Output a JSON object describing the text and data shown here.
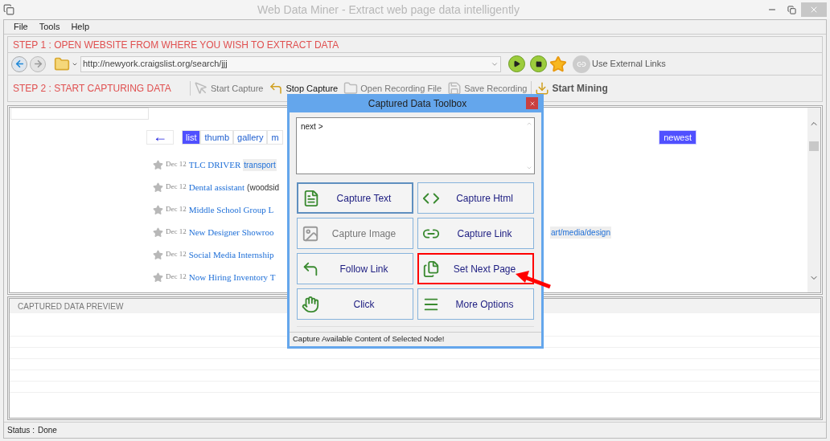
{
  "window": {
    "title": "Web Data Miner -  Extract web page data intelligently"
  },
  "menu": [
    "File",
    "Tools",
    "Help"
  ],
  "step1": {
    "label": "STEP 1 : OPEN WEBSITE FROM WHERE YOU WISH TO EXTRACT DATA"
  },
  "address_bar": {
    "url": "http://newyork.craigslist.org/search/jjj",
    "external_links": "Use External Links"
  },
  "step2": {
    "label": "STEP 2 : START CAPTURING DATA",
    "tools": [
      {
        "label": "Start Capture",
        "disabled": true,
        "kind": "action"
      },
      {
        "label": "Stop Capture",
        "disabled": false,
        "kind": "action"
      },
      {
        "label": "Open Recording File",
        "disabled": true,
        "kind": "action"
      },
      {
        "label": "Save Recording",
        "disabled": true,
        "kind": "action"
      },
      {
        "label": "Start Mining",
        "disabled": false,
        "kind": "primary"
      }
    ]
  },
  "browser": {
    "back_link": "←",
    "view_tabs": [
      {
        "label": "list",
        "selected": true
      },
      {
        "label": "thumb",
        "selected": false
      },
      {
        "label": "gallery",
        "selected": false
      },
      {
        "label": "m",
        "selected": false
      }
    ],
    "sort": "newest",
    "listings": [
      {
        "date": "Dec 12",
        "title": "TLC DRIVER",
        "category": {
          "text": "transport",
          "kind": "inline"
        }
      },
      {
        "date": "Dec 12",
        "title": "Dental assistant",
        "location": "(woodsid"
      },
      {
        "date": "Dec 12",
        "title": "Middle School Group L"
      },
      {
        "date": "Dec 12",
        "title": "New Designer Showroo",
        "category": {
          "text": "art/media/design",
          "kind": "far"
        }
      },
      {
        "date": "Dec 12",
        "title": "Social Media Internship"
      },
      {
        "date": "Dec 12",
        "title": "Now Hiring Inventory T"
      }
    ]
  },
  "toolbox": {
    "title": "Captured Data Toolbox",
    "selected_text": "next >",
    "buttons": [
      {
        "label": "Capture Text",
        "focused": true,
        "highlighted": false,
        "disabled": false
      },
      {
        "label": "Capture Html",
        "focused": false,
        "highlighted": false,
        "disabled": false
      },
      {
        "label": "Capture Image",
        "focused": false,
        "highlighted": false,
        "disabled": true
      },
      {
        "label": "Capture Link",
        "focused": false,
        "highlighted": false,
        "disabled": false
      },
      {
        "label": "Follow Link",
        "focused": false,
        "highlighted": false,
        "disabled": false
      },
      {
        "label": "Set Next Page",
        "focused": false,
        "highlighted": true,
        "disabled": false
      },
      {
        "label": "Click",
        "focused": false,
        "highlighted": false,
        "disabled": false
      },
      {
        "label": "More Options",
        "focused": false,
        "highlighted": false,
        "disabled": false
      }
    ],
    "status": "Capture Available Content of Selected Node!"
  },
  "preview": {
    "title": "CAPTURED DATA PREVIEW"
  },
  "status_bar": {
    "label": "Status :",
    "value": "Done"
  }
}
